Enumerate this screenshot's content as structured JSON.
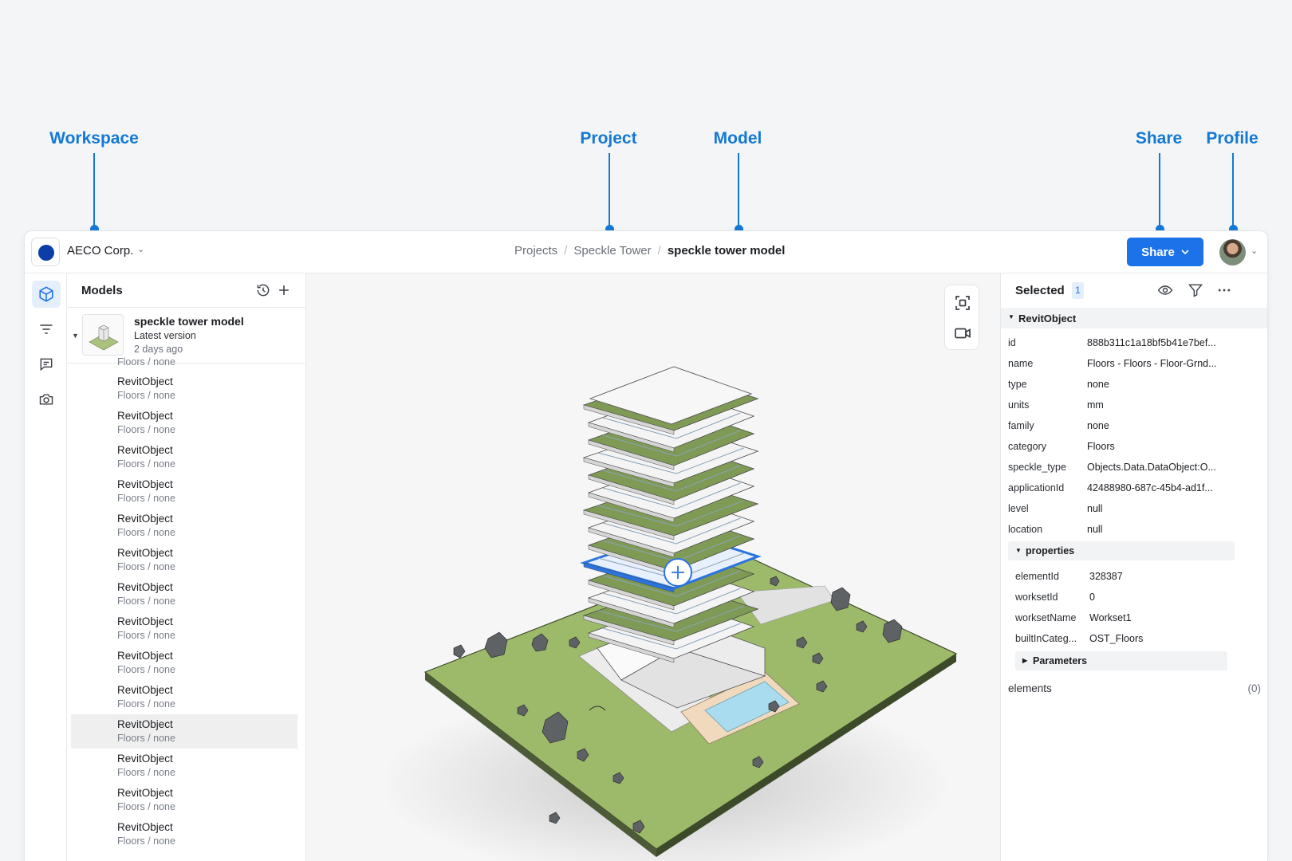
{
  "callouts": {
    "workspace": "Workspace",
    "project": "Project",
    "model": "Model",
    "share": "Share",
    "profile": "Profile"
  },
  "header": {
    "workspace_name": "AECO Corp.",
    "breadcrumb": {
      "projects": "Projects",
      "project": "Speckle Tower",
      "model": "speckle tower model"
    },
    "share_label": "Share"
  },
  "models_panel": {
    "title": "Models",
    "model": {
      "name": "speckle tower model",
      "version": "Latest version",
      "age": "2 days ago"
    },
    "partial_row_text": "Floors / none",
    "items": [
      {
        "name": "RevitObject",
        "sub": "Floors / none"
      },
      {
        "name": "RevitObject",
        "sub": "Floors / none"
      },
      {
        "name": "RevitObject",
        "sub": "Floors / none"
      },
      {
        "name": "RevitObject",
        "sub": "Floors / none"
      },
      {
        "name": "RevitObject",
        "sub": "Floors / none"
      },
      {
        "name": "RevitObject",
        "sub": "Floors / none"
      },
      {
        "name": "RevitObject",
        "sub": "Floors / none"
      },
      {
        "name": "RevitObject",
        "sub": "Floors / none"
      },
      {
        "name": "RevitObject",
        "sub": "Floors / none"
      },
      {
        "name": "RevitObject",
        "sub": "Floors / none"
      },
      {
        "name": "RevitObject",
        "sub": "Floors / none"
      },
      {
        "name": "RevitObject",
        "sub": "Floors / none"
      },
      {
        "name": "RevitObject",
        "sub": "Floors / none"
      },
      {
        "name": "RevitObject",
        "sub": "Floors / none"
      }
    ],
    "selected_index": 10
  },
  "selection_panel": {
    "title": "Selected",
    "count": "1",
    "section": "RevitObject",
    "props": [
      {
        "k": "id",
        "v": "888b311c1a18bf5b41e7bef..."
      },
      {
        "k": "name",
        "v": "Floors - Floors - Floor-Grnd..."
      },
      {
        "k": "type",
        "v": "none"
      },
      {
        "k": "units",
        "v": "mm"
      },
      {
        "k": "family",
        "v": "none"
      },
      {
        "k": "category",
        "v": "Floors"
      },
      {
        "k": "speckle_type",
        "v": "Objects.Data.DataObject:O..."
      },
      {
        "k": "applicationId",
        "v": "42488980-687c-45b4-ad1f..."
      },
      {
        "k": "level",
        "v": "null"
      },
      {
        "k": "location",
        "v": "null"
      }
    ],
    "properties_label": "properties",
    "sub_props": [
      {
        "k": "elementId",
        "v": "328387"
      },
      {
        "k": "worksetId",
        "v": "0"
      },
      {
        "k": "worksetName",
        "v": "Workset1"
      },
      {
        "k": "builtInCateg...",
        "v": "OST_Floors"
      }
    ],
    "parameters_label": "Parameters",
    "elements_label": "elements",
    "elements_count": "(0)"
  },
  "colors": {
    "accent": "#1c72e8",
    "callout": "#1479d4",
    "workspace_logo": "#0b3ea8",
    "selected_floor": "#2a74e0",
    "ground": "#9dba6a"
  },
  "icons": {
    "rail": [
      "cube-icon",
      "filter-lines-icon",
      "comment-icon",
      "camera-icon"
    ],
    "viewer_tools": [
      "frame-icon",
      "video-camera-icon"
    ],
    "selection_tools": [
      "eye-icon",
      "filter-icon",
      "more-icon"
    ]
  }
}
